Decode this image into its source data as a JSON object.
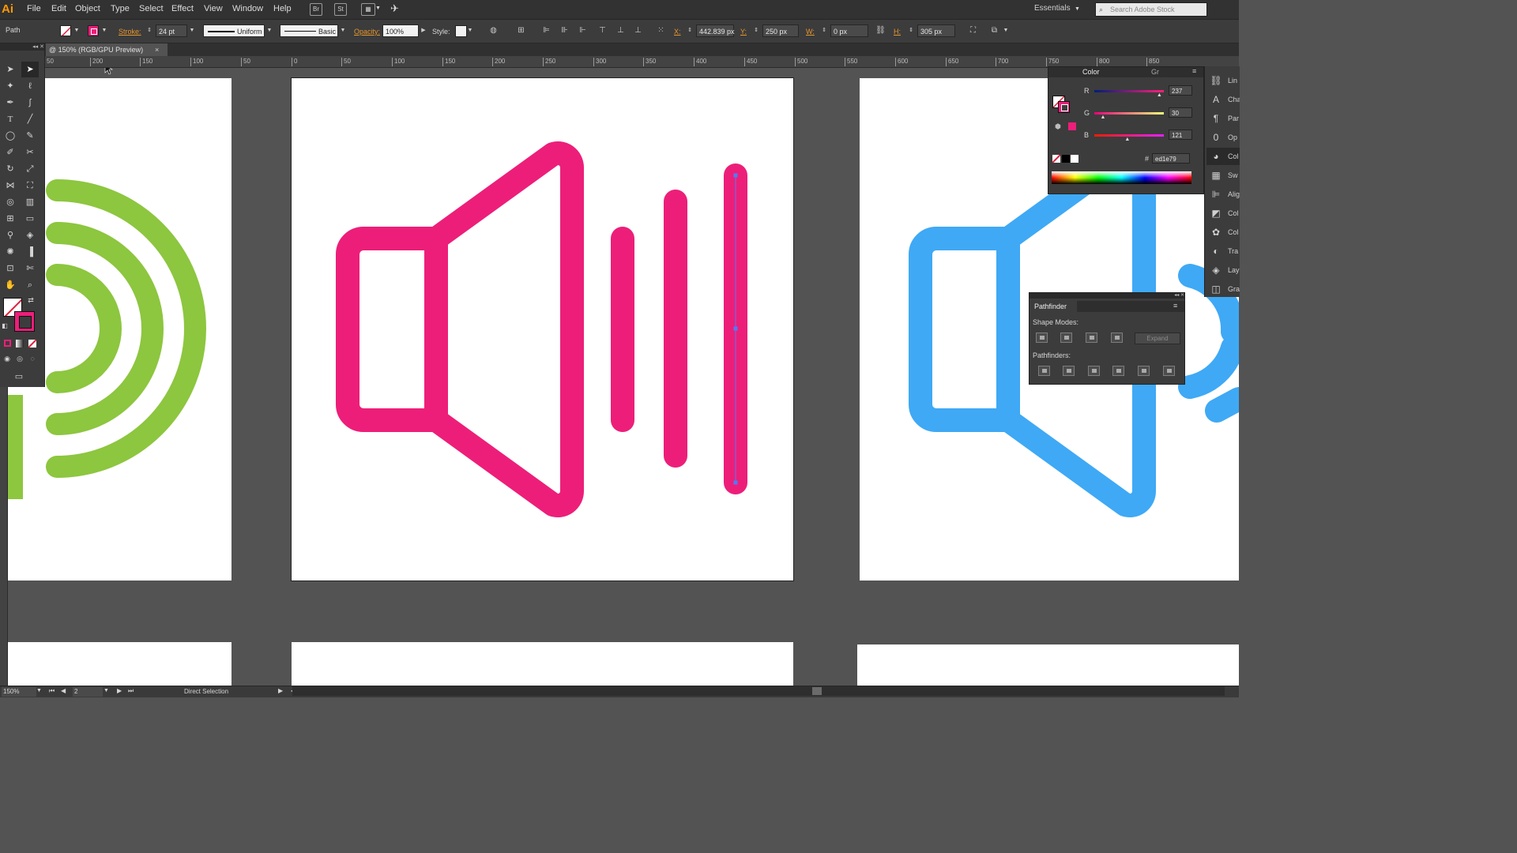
{
  "app": {
    "logo": "Ai"
  },
  "menubar": {
    "items": [
      "File",
      "Edit",
      "Object",
      "Type",
      "Select",
      "Effect",
      "View",
      "Window",
      "Help"
    ],
    "bridge_label": "Br",
    "stock_label": "St",
    "workspace": "Essentials",
    "search_placeholder": "Search Adobe Stock"
  },
  "controlbar": {
    "object_type": "Path",
    "stroke_label": "Stroke:",
    "stroke_weight": "24 pt",
    "profile": "Uniform",
    "brush": "Basic",
    "opacity_label": "Opacity:",
    "opacity": "100%",
    "style_label": "Style:",
    "x_label": "X:",
    "x_value": "442.839 px",
    "y_label": "Y:",
    "y_value": "250 px",
    "w_label": "W:",
    "w_value": "0 px",
    "h_label": "H:",
    "h_value": "305 px"
  },
  "document": {
    "tab_title": "@ 150% (RGB/GPU Preview)",
    "close_glyph": "×"
  },
  "ruler": {
    "ticks": [
      "50",
      "200",
      "150",
      "100",
      "50",
      "0",
      "50",
      "100",
      "150",
      "200",
      "250",
      "300",
      "350",
      "400",
      "450",
      "500",
      "550",
      "600",
      "650",
      "700",
      "750",
      "800",
      "850"
    ]
  },
  "color_panel": {
    "title": "Color",
    "other_tab": "Gr",
    "r_label": "R",
    "r_value": "237",
    "r_fraction": 0.93,
    "g_label": "G",
    "g_value": "30",
    "g_fraction": 0.12,
    "b_label": "B",
    "b_value": "121",
    "b_fraction": 0.47,
    "hex_label": "#",
    "hex_value": "ed1e79"
  },
  "right_dock": {
    "items": [
      {
        "label": "Lin",
        "icon": "link-icon"
      },
      {
        "label": "Cha",
        "icon": "character-icon"
      },
      {
        "label": "Par",
        "icon": "paragraph-icon"
      },
      {
        "label": "Op",
        "icon": "opentype-icon"
      },
      {
        "label": "Col",
        "icon": "color-icon"
      },
      {
        "label": "Sw",
        "icon": "swatches-icon"
      },
      {
        "label": "Alig",
        "icon": "align-icon"
      },
      {
        "label": "Col",
        "icon": "color-guide-icon"
      },
      {
        "label": "Col",
        "icon": "color-themes-icon"
      },
      {
        "label": "Tra",
        "icon": "transparency-icon"
      },
      {
        "label": "Lay",
        "icon": "layers-icon"
      },
      {
        "label": "Gra",
        "icon": "graphic-styles-icon"
      }
    ]
  },
  "pathfinder": {
    "title": "Pathfinder",
    "shape_modes_label": "Shape Modes:",
    "expand_label": "Expand",
    "pathfinders_label": "Pathfinders:"
  },
  "statusbar": {
    "zoom": "150%",
    "artboard_number": "2",
    "tool_status": "Direct Selection"
  },
  "colors": {
    "accent_pink": "#ed1e79",
    "green": "#8dc63f",
    "blue": "#3fa9f5",
    "canvas": "#535353"
  }
}
